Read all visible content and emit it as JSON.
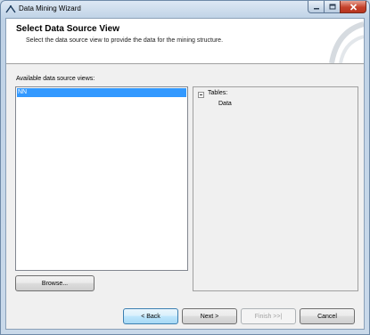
{
  "window": {
    "title": "Data Mining Wizard",
    "caption_min": "—",
    "caption_max": "□",
    "caption_close": "✕"
  },
  "header": {
    "title": "Select Data Source View",
    "subtitle": "Select the data source view to provide the data for the mining structure."
  },
  "sources": {
    "label": "Available data source views:",
    "items": [
      "NN"
    ],
    "selected": "NN"
  },
  "tree": {
    "root": "Tables:",
    "children": [
      "Data"
    ]
  },
  "buttons": {
    "browse": "Browse...",
    "back": "< Back",
    "next": "Next >",
    "finish": "Finish >>|",
    "cancel": "Cancel"
  },
  "colors": {
    "selection": "#3399ff",
    "close_button": "#c5412a",
    "window_frame": "#c9d9ea"
  }
}
